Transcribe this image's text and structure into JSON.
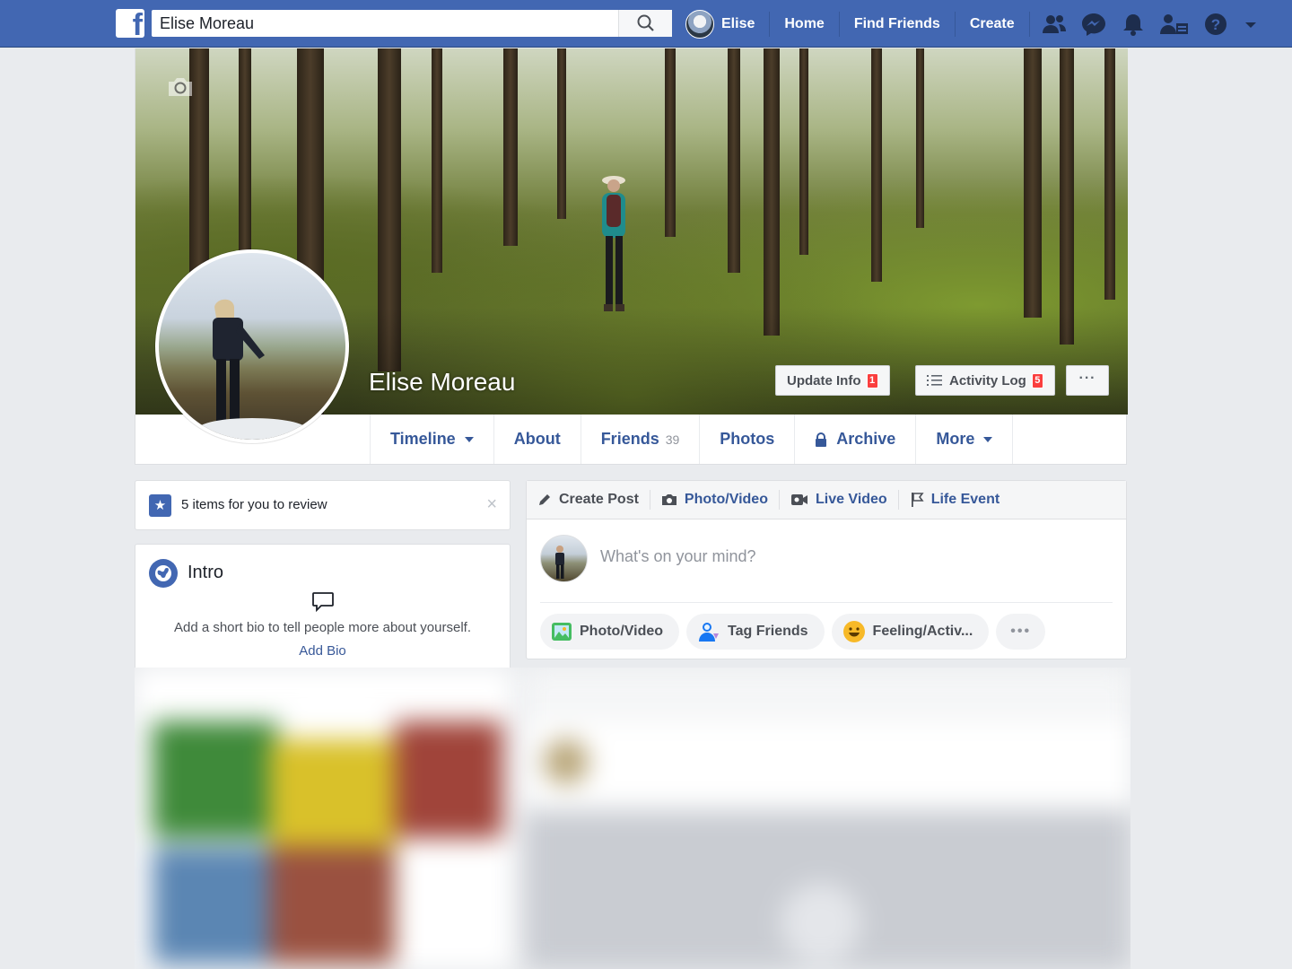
{
  "topbar": {
    "search_value": "Elise Moreau",
    "user_name": "Elise",
    "links": [
      "Home",
      "Find Friends",
      "Create"
    ]
  },
  "profile": {
    "name": "Elise Moreau",
    "update_info_label": "Update Info",
    "update_info_badge": "1",
    "activity_log_label": "Activity Log",
    "activity_log_badge": "5",
    "more_dots": "···"
  },
  "tabs": [
    {
      "label": "Timeline"
    },
    {
      "label": "About"
    },
    {
      "label": "Friends",
      "count": "39"
    },
    {
      "label": "Photos"
    },
    {
      "label": "Archive"
    },
    {
      "label": "More"
    }
  ],
  "review": {
    "text": "5 items for you to review",
    "close": "×"
  },
  "intro": {
    "title": "Intro",
    "text": "Add a short bio to tell people more about yourself.",
    "add_bio": "Add Bio"
  },
  "composer": {
    "head": [
      "Create Post",
      "Photo/Video",
      "Live Video",
      "Life Event"
    ],
    "placeholder": "What's on your mind?",
    "actions": [
      "Photo/Video",
      "Tag Friends",
      "Feeling/Activ..."
    ],
    "more": "•••"
  },
  "colors": {
    "brand": "#4267b2",
    "link": "#365899",
    "badge": "#fa3e3e",
    "background": "#e9ebee"
  }
}
